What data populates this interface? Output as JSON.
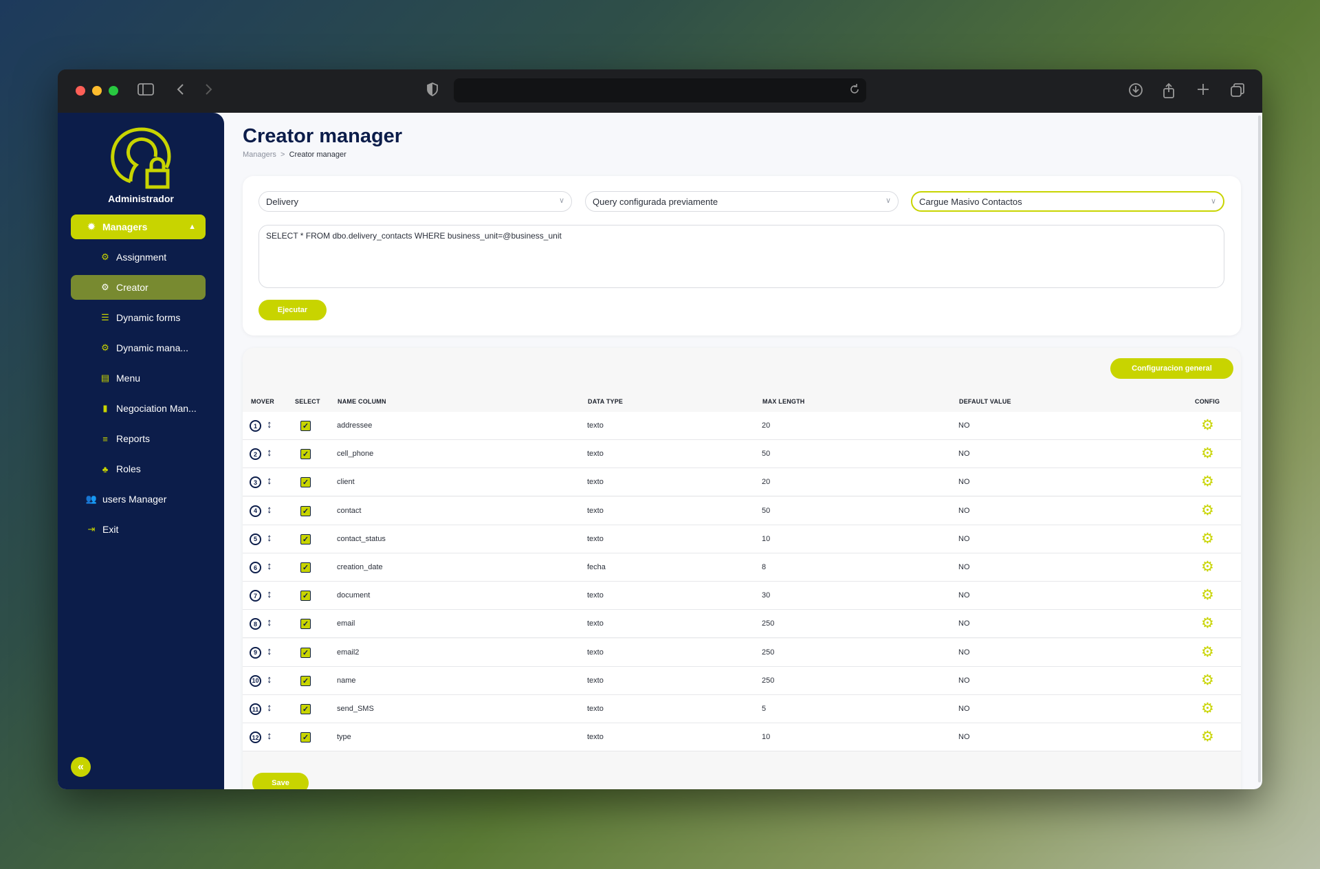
{
  "browser": {
    "url": ""
  },
  "sidebar": {
    "role": "Administrador",
    "managers_label": "Managers",
    "items": [
      {
        "label": "Assignment",
        "icon": "gears-icon"
      },
      {
        "label": "Creator",
        "icon": "gears-icon"
      },
      {
        "label": "Dynamic forms",
        "icon": "list-icon"
      },
      {
        "label": "Dynamic mana...",
        "icon": "gears-icon"
      },
      {
        "label": "Menu",
        "icon": "menu-tree-icon"
      },
      {
        "label": "Negociation Man...",
        "icon": "document-icon"
      },
      {
        "label": "Reports",
        "icon": "lines-icon"
      },
      {
        "label": "Roles",
        "icon": "sitemap-icon"
      }
    ],
    "users_manager": "users Manager",
    "exit": "Exit"
  },
  "page": {
    "title": "Creator manager",
    "breadcrumb_parent": "Managers",
    "breadcrumb_sep": ">",
    "breadcrumb_current": "Creator manager"
  },
  "query": {
    "select1": "Delivery",
    "select2": "Query configurada previamente",
    "select3": "Cargue Masivo Contactos",
    "sql": "SELECT * FROM dbo.delivery_contacts WHERE business_unit=@business_unit",
    "execute_label": "Ejecutar"
  },
  "table": {
    "config_general_label": "Configuracion general",
    "headers": {
      "mover": "MOVER",
      "select": "SELECT",
      "name": "NAME COLUMN",
      "type": "DATA TYPE",
      "max": "MAX LENGTH",
      "default": "DEFAULT VALUE",
      "config": "CONFIG"
    },
    "rows": [
      {
        "n": "1",
        "name": "addressee",
        "type": "texto",
        "max": "20",
        "def": "NO"
      },
      {
        "n": "2",
        "name": "cell_phone",
        "type": "texto",
        "max": "50",
        "def": "NO"
      },
      {
        "n": "3",
        "name": "client",
        "type": "texto",
        "max": "20",
        "def": "NO"
      },
      {
        "n": "4",
        "name": "contact",
        "type": "texto",
        "max": "50",
        "def": "NO"
      },
      {
        "n": "5",
        "name": "contact_status",
        "type": "texto",
        "max": "10",
        "def": "NO"
      },
      {
        "n": "6",
        "name": "creation_date",
        "type": "fecha",
        "max": "8",
        "def": "NO"
      },
      {
        "n": "7",
        "name": "document",
        "type": "texto",
        "max": "30",
        "def": "NO"
      },
      {
        "n": "8",
        "name": "email",
        "type": "texto",
        "max": "250",
        "def": "NO"
      },
      {
        "n": "9",
        "name": "email2",
        "type": "texto",
        "max": "250",
        "def": "NO"
      },
      {
        "n": "10",
        "name": "name",
        "type": "texto",
        "max": "250",
        "def": "NO"
      },
      {
        "n": "11",
        "name": "send_SMS",
        "type": "texto",
        "max": "5",
        "def": "NO"
      },
      {
        "n": "12",
        "name": "type",
        "type": "texto",
        "max": "10",
        "def": "NO"
      }
    ],
    "save_label": "Save"
  },
  "colors": {
    "accent": "#c8d400",
    "sidebar": "#0c1d4a",
    "active_item": "#788a30"
  }
}
